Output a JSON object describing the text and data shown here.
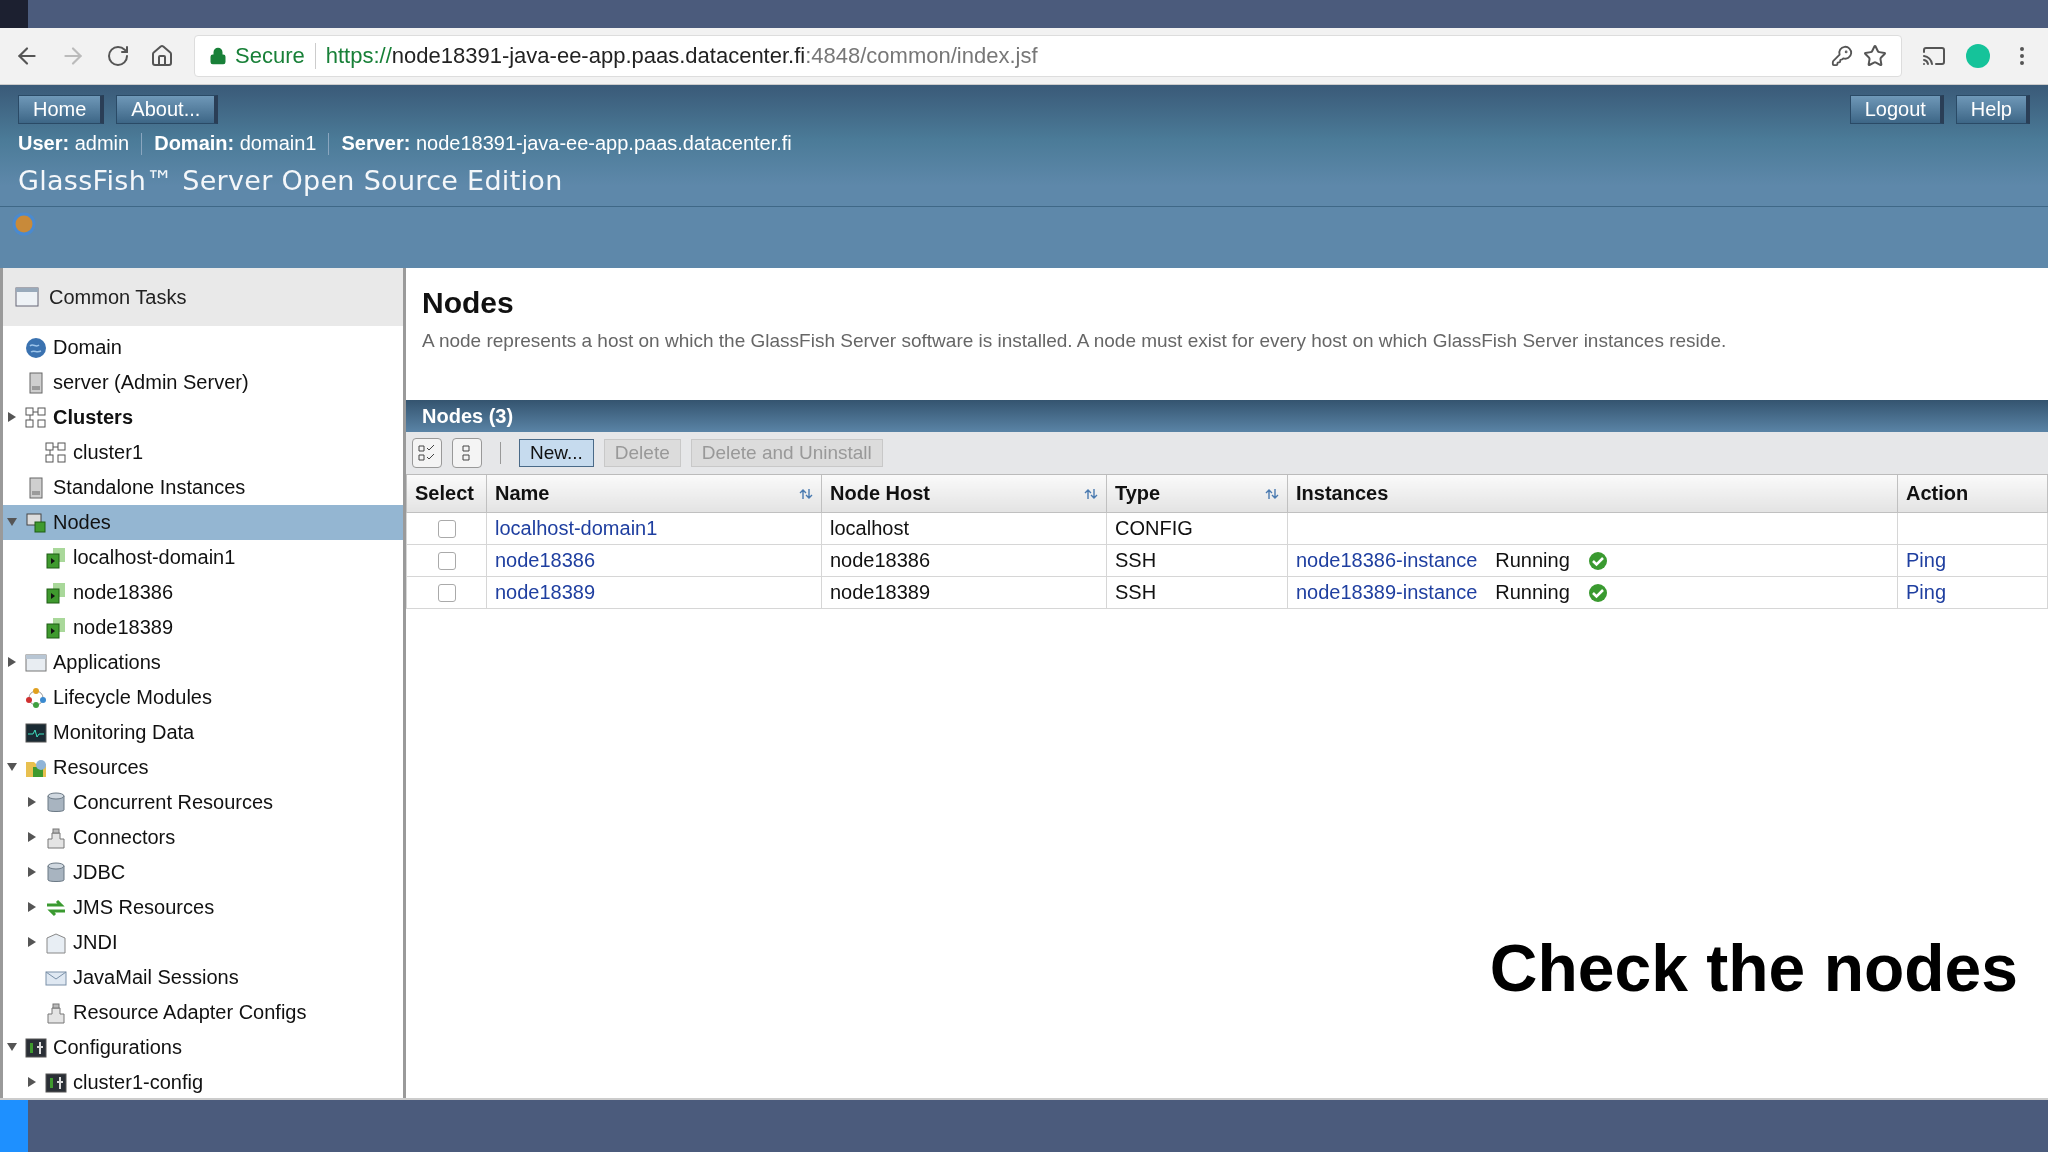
{
  "browser": {
    "security": "Secure",
    "url": {
      "scheme": "https://",
      "host": "node18391-java-ee-app.paas.datacenter.fi",
      "path": ":4848/common/index.jsf"
    }
  },
  "header": {
    "left_buttons": [
      "Home",
      "About..."
    ],
    "right_buttons": [
      "Logout",
      "Help"
    ],
    "info": [
      {
        "label": "User:",
        "value": "admin"
      },
      {
        "label": "Domain:",
        "value": "domain1"
      },
      {
        "label": "Server:",
        "value": "node18391-java-ee-app.paas.datacenter.fi"
      }
    ],
    "title": "GlassFish™ Server Open Source Edition"
  },
  "sidebar": {
    "title": "Common Tasks",
    "items": [
      {
        "label": "Domain",
        "kind": "globe",
        "bold": false,
        "selected": false
      },
      {
        "label": "server (Admin Server)",
        "kind": "server",
        "bold": false,
        "selected": false
      },
      {
        "label": "Clusters",
        "kind": "cluster",
        "bold": true,
        "selected": false,
        "expanded": false,
        "children": [
          {
            "label": "cluster1",
            "kind": "cluster",
            "bold": false,
            "selected": false
          }
        ]
      },
      {
        "label": "Standalone Instances",
        "kind": "server",
        "bold": false,
        "selected": false
      },
      {
        "label": "Nodes",
        "kind": "nodes",
        "bold": false,
        "selected": true,
        "expanded": true,
        "children": [
          {
            "label": "localhost-domain1",
            "kind": "node",
            "bold": false,
            "selected": false
          },
          {
            "label": "node18386",
            "kind": "node",
            "bold": false,
            "selected": false
          },
          {
            "label": "node18389",
            "kind": "node",
            "bold": false,
            "selected": false
          }
        ]
      },
      {
        "label": "Applications",
        "kind": "window",
        "bold": false,
        "selected": false,
        "expanded": false
      },
      {
        "label": "Lifecycle Modules",
        "kind": "lifecycle",
        "bold": false,
        "selected": false
      },
      {
        "label": "Monitoring Data",
        "kind": "monitor",
        "bold": false,
        "selected": false
      },
      {
        "label": "Resources",
        "kind": "resources",
        "bold": false,
        "selected": false,
        "expanded": true,
        "children": [
          {
            "label": "Concurrent Resources",
            "kind": "database",
            "bold": false,
            "selected": false,
            "expanded": false
          },
          {
            "label": "Connectors",
            "kind": "connector",
            "bold": false,
            "selected": false,
            "expanded": false
          },
          {
            "label": "JDBC",
            "kind": "database",
            "bold": false,
            "selected": false,
            "expanded": false
          },
          {
            "label": "JMS Resources",
            "kind": "jms",
            "bold": false,
            "selected": false,
            "expanded": false
          },
          {
            "label": "JNDI",
            "kind": "jndi",
            "bold": false,
            "selected": false,
            "expanded": false
          },
          {
            "label": "JavaMail Sessions",
            "kind": "mail",
            "bold": false,
            "selected": false
          },
          {
            "label": "Resource Adapter Configs",
            "kind": "connector",
            "bold": false,
            "selected": false
          }
        ]
      },
      {
        "label": "Configurations",
        "kind": "config",
        "bold": false,
        "selected": false,
        "expanded": true,
        "children": [
          {
            "label": "cluster1-config",
            "kind": "config",
            "bold": false,
            "selected": false,
            "expanded": false
          }
        ]
      }
    ]
  },
  "page": {
    "title": "Nodes",
    "description": "A node represents a host on which the GlassFish Server software is installed. A node must exist for every host on which GlassFish Server instances reside."
  },
  "table": {
    "title": "Nodes (3)",
    "buttons": [
      {
        "label": "New...",
        "disabled": false
      },
      {
        "label": "Delete",
        "disabled": true
      },
      {
        "label": "Delete and Uninstall",
        "disabled": true
      }
    ],
    "columns": [
      {
        "label": "Select",
        "sortable": false
      },
      {
        "label": "Name",
        "sortable": true
      },
      {
        "label": "Node Host",
        "sortable": true
      },
      {
        "label": "Type",
        "sortable": true
      },
      {
        "label": "Instances",
        "sortable": false
      },
      {
        "label": "Action",
        "sortable": false
      }
    ],
    "rows": [
      {
        "checked": false,
        "name": "localhost-domain1",
        "host": "localhost",
        "type": "CONFIG"
      },
      {
        "checked": false,
        "name": "node18386",
        "host": "node18386",
        "type": "SSH",
        "instance": "node18386-instance",
        "status": "Running",
        "action": "Ping"
      },
      {
        "checked": false,
        "name": "node18389",
        "host": "node18389",
        "type": "SSH",
        "instance": "node18389-instance",
        "status": "Running",
        "action": "Ping"
      }
    ]
  },
  "caption": "Check the nodes"
}
